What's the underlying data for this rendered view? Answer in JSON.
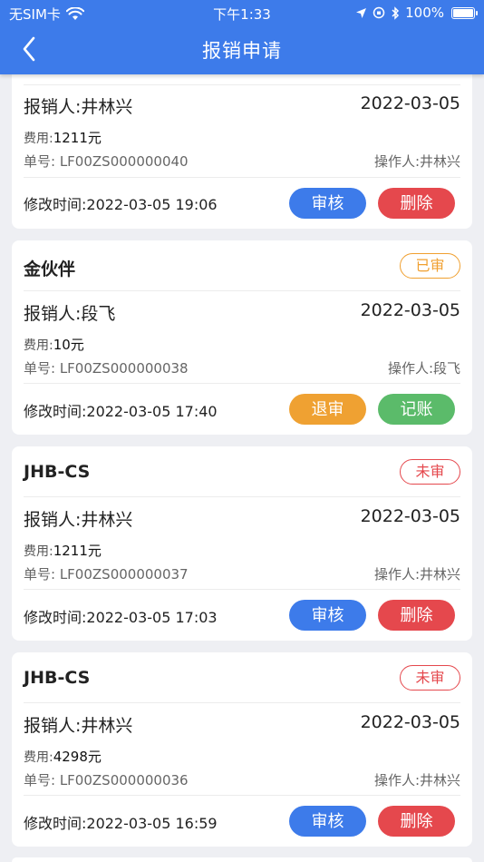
{
  "status_bar": {
    "carrier": "无SIM卡",
    "time": "下午1:33",
    "battery": "100%"
  },
  "header": {
    "title": "报销申请"
  },
  "cards": [
    {
      "title": "",
      "badge": "",
      "person": "报销人:井林兴",
      "date": "2022-03-05",
      "fee_label": "费用:",
      "fee_value": "1211元",
      "number": "单号:  LF00ZS000000040",
      "operator": "操作人:井林兴",
      "modified": "修改时间:2022-03-05 19:06",
      "btn1": "审核",
      "btn2": "删除"
    },
    {
      "title": "金伙伴",
      "badge": "已审",
      "person": "报销人:段飞",
      "date": "2022-03-05",
      "fee_label": "费用:",
      "fee_value": "10元",
      "number": "单号:  LF00ZS000000038",
      "operator": "操作人:段飞",
      "modified": "修改时间:2022-03-05 17:40",
      "btn1": "退审",
      "btn2": "记账"
    },
    {
      "title": "JHB-CS",
      "badge": "未审",
      "person": "报销人:井林兴",
      "date": "2022-03-05",
      "fee_label": "费用:",
      "fee_value": "1211元",
      "number": "单号:  LF00ZS000000037",
      "operator": "操作人:井林兴",
      "modified": "修改时间:2022-03-05 17:03",
      "btn1": "审核",
      "btn2": "删除"
    },
    {
      "title": "JHB-CS",
      "badge": "未审",
      "person": "报销人:井林兴",
      "date": "2022-03-05",
      "fee_label": "费用:",
      "fee_value": "4298元",
      "number": "单号:  LF00ZS000000036",
      "operator": "操作人:井林兴",
      "modified": "修改时间:2022-03-05 16:59",
      "btn1": "审核",
      "btn2": "删除"
    }
  ],
  "colors": {
    "primary": "#3d7bea",
    "danger": "#e5484d",
    "warning": "#efa132",
    "success": "#5bbb6a",
    "background": "#eeeff3"
  }
}
